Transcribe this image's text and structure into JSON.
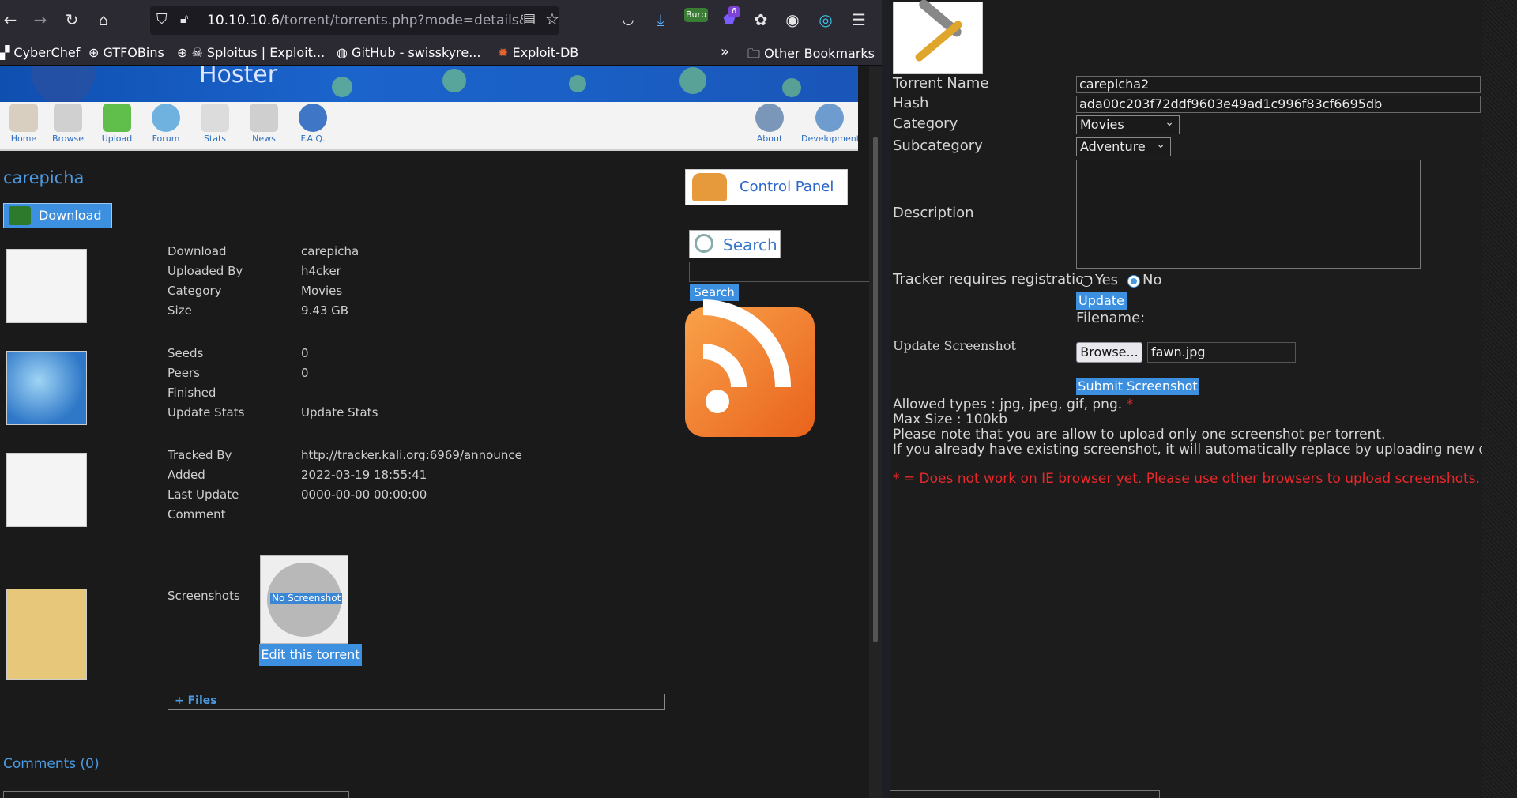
{
  "browser": {
    "url_main": "10.10.10.6",
    "url_rest": "/torrent/torrents.php?mode=details&id=",
    "bookmarks": [
      "CyberChef",
      "GTFOBins",
      "Sploitus | Exploit...",
      "GitHub - swisskyre...",
      "Exploit-DB",
      "Other Bookmarks"
    ],
    "burp_label": "Burp",
    "badge_count": "6"
  },
  "site": {
    "banner_title": "Hoster",
    "nav": [
      "Home",
      "Browse",
      "Upload",
      "Forum",
      "Stats",
      "News",
      "F.A.Q."
    ],
    "nav_right": [
      "About",
      "Development"
    ]
  },
  "torrent": {
    "title": "carepicha",
    "download_label": "Download",
    "rows": [
      {
        "label": "Download",
        "value": "carepicha",
        "link": true
      },
      {
        "label": "Uploaded By",
        "value": "h4cker",
        "link": true
      },
      {
        "label": "Category",
        "value": "Movies",
        "link": false
      },
      {
        "label": "Size",
        "value": "9.43 GB",
        "link": false
      },
      {
        "label": "Seeds",
        "value": "0",
        "link": false
      },
      {
        "label": "Peers",
        "value": "0",
        "link": false
      },
      {
        "label": "Finished",
        "value": "",
        "link": false
      },
      {
        "label": "Update Stats",
        "value": "Update Stats",
        "link": true
      },
      {
        "label": "Tracked By",
        "value": "http://tracker.kali.org:6969/announce",
        "link": false
      },
      {
        "label": "Added",
        "value": "2022-03-19 18:55:41",
        "link": false
      },
      {
        "label": "Last Update",
        "value": "0000-00-00 00:00:00",
        "link": false
      },
      {
        "label": "Comment",
        "value": "",
        "link": false
      }
    ],
    "screenshots_label": "Screenshots",
    "no_screenshot_label": "No Screenshot",
    "edit_button": "Edit this torrent",
    "files_label": "+ Files",
    "comments_label": "Comments (0)"
  },
  "sidebar": {
    "control_panel": "Control Panel",
    "search_title": "Search",
    "search_button": "Search"
  },
  "edit_form": {
    "torrent_name_label": "Torrent Name",
    "torrent_name_value": "carepicha2",
    "hash_label": "Hash",
    "hash_value": "ada00c203f72ddf9603e49ad1c996f83cf6695db",
    "category_label": "Category",
    "category_value": "Movies",
    "subcategory_label": "Subcategory",
    "subcategory_value": "Adventure",
    "description_label": "Description",
    "tracker_label": "Tracker requires registration",
    "yes_label": "Yes",
    "no_label": "No",
    "update_button": "Update",
    "filename_label": "Filename:",
    "update_screenshot_label": "Update Screenshot",
    "browse_button": "Browse...",
    "file_value": "fawn.jpg",
    "submit_button": "Submit Screenshot",
    "allowed_types": "Allowed types : jpg, jpeg, gif, png.",
    "asterisk": "*",
    "max_size": "Max Size : 100kb",
    "note1": "Please note that you are allow to upload only one screenshot per torrent.",
    "note2": "If you already have existing screenshot, it will automatically replace by uploading new one.",
    "ie_warning": "* = Does not work on IE browser yet. Please use other browsers to upload screenshots."
  },
  "icons": [
    "back-icon",
    "forward-icon",
    "reload-icon",
    "home-icon",
    "shield-icon",
    "lock-icon",
    "reader-icon",
    "star-icon",
    "pocket-icon",
    "download-icon",
    "menu-icon",
    "folder-icon",
    "rss-icon",
    "tools-icon"
  ],
  "colors": {
    "link": "#4a9be3",
    "button": "#3d8fe0",
    "warning": "#e8282b"
  }
}
